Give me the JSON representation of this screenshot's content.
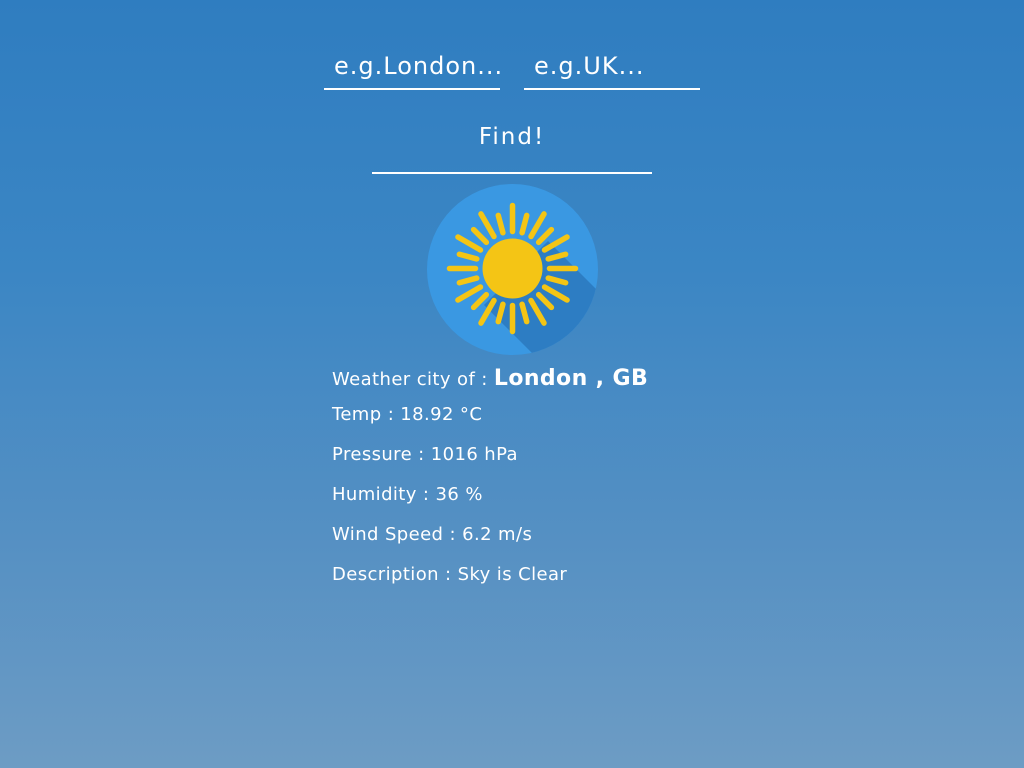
{
  "search": {
    "city_placeholder": "e.g.London...",
    "country_placeholder": "e.g.UK...",
    "find_label": "Find!"
  },
  "weather": {
    "icon": "sun-icon",
    "city_label": "Weather city of :",
    "city": "London , GB",
    "temp": "Temp : 18.92 °C",
    "pressure": "Pressure : 1016 hPa",
    "humidity": "Humidity : 36 %",
    "wind": "Wind Speed : 6.2 m/s",
    "description": "Description : Sky is Clear"
  },
  "colors": {
    "background_top": "#2f7dc0",
    "background_bottom": "#6d9cc4",
    "icon_circle": "#3a98e2",
    "icon_shadow": "#2c78bd",
    "sun": "#f4c515",
    "text": "#ffffff"
  }
}
